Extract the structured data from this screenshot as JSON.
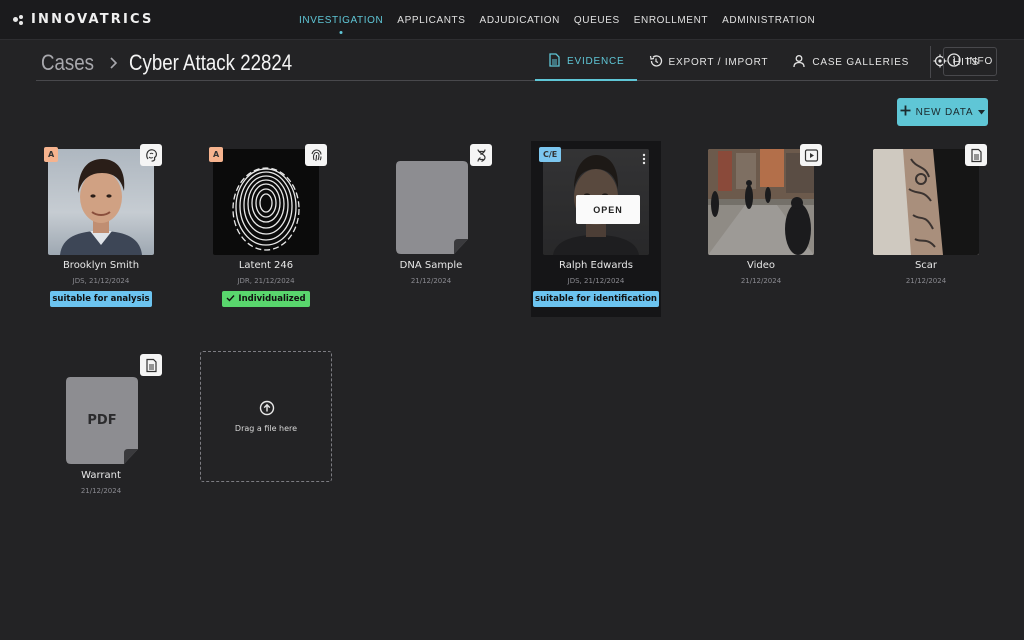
{
  "app": {
    "logo_text": "INNOVATRICS"
  },
  "nav": {
    "items": [
      {
        "label": "INVESTIGATION"
      },
      {
        "label": "APPLICANTS"
      },
      {
        "label": "ADJUDICATION"
      },
      {
        "label": "QUEUES"
      },
      {
        "label": "ENROLLMENT"
      },
      {
        "label": "ADMINISTRATION"
      }
    ]
  },
  "breadcrumb": {
    "root": "Cases",
    "separator": ">",
    "current": "Cyber Attack 22824"
  },
  "tabs": {
    "evidence": "EVIDENCE",
    "export_import": "EXPORT / IMPORT",
    "case_galleries": "CASE GALLERIES",
    "hits": "HITS",
    "info": "INFO"
  },
  "actions": {
    "new_data": "NEW DATA"
  },
  "cards": {
    "brooklyn": {
      "badge": "A",
      "name": "Brooklyn Smith",
      "meta": "JDS, 21/12/2024",
      "tag": "suitable for analysis",
      "icon": "face-icon"
    },
    "latent": {
      "badge": "A",
      "name": "Latent 246",
      "meta": "JDR, 21/12/2024",
      "tag": "Individualized",
      "icon": "fingerprint-icon"
    },
    "dna": {
      "name": "DNA Sample",
      "meta": "21/12/2024",
      "icon": "dna-icon"
    },
    "ralph": {
      "badge": "C/E",
      "name": "Ralph Edwards",
      "meta": "JDS, 21/12/2024",
      "tag": "suitable for identification",
      "open": "OPEN"
    },
    "video": {
      "name": "Video",
      "meta": "21/12/2024",
      "icon": "play-icon"
    },
    "scar": {
      "name": "Scar",
      "meta": "21/12/2024",
      "icon": "document-icon"
    },
    "warrant": {
      "name": "Warrant",
      "meta": "21/12/2024",
      "doc_label": "PDF",
      "icon": "document-icon"
    }
  },
  "dropzone": {
    "text": "Drag a file here"
  },
  "colors": {
    "accent": "#5fc6d6",
    "badge_a": "#f6b38e",
    "badge_ce": "#7cc6ef",
    "tag_blue": "#6cc4f0",
    "tag_green": "#59d66d",
    "background": "#232325"
  }
}
